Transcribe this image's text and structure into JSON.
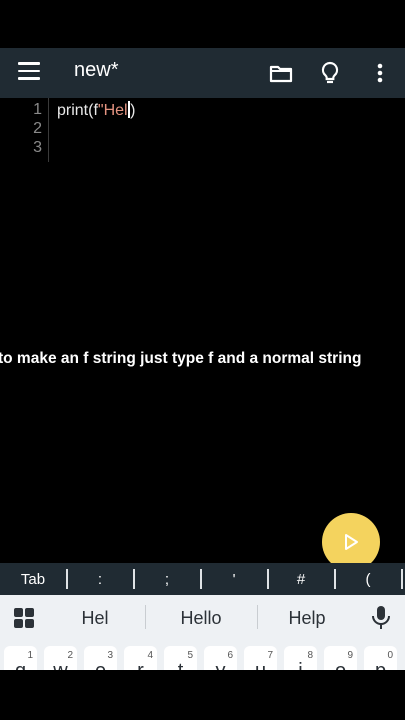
{
  "app_bar": {
    "title": "new*",
    "icons": [
      "menu-icon",
      "folder-icon",
      "lightbulb-icon",
      "more-vert-icon"
    ]
  },
  "editor": {
    "line_numbers": [
      "1",
      "2",
      "3"
    ],
    "line1": {
      "before": "print(f",
      "string": "\"Hel",
      "after": ")"
    }
  },
  "caption": "to make an f string just type f and a normal string",
  "run_button": {
    "icon": "play-icon",
    "color": "#f4d35e"
  },
  "symbol_bar": {
    "items": [
      "Tab",
      ":",
      ";",
      "'",
      "#",
      "("
    ]
  },
  "suggestions": {
    "items": [
      "Hel",
      "Hello",
      "Help"
    ],
    "icons": [
      "keyboard-grid-icon",
      "mic-icon"
    ]
  },
  "keyboard": {
    "keys": [
      {
        "char": "q",
        "hint": "1"
      },
      {
        "char": "w",
        "hint": "2"
      },
      {
        "char": "e",
        "hint": "3"
      },
      {
        "char": "r",
        "hint": "4"
      },
      {
        "char": "t",
        "hint": "5"
      },
      {
        "char": "y",
        "hint": "6"
      },
      {
        "char": "u",
        "hint": "7"
      },
      {
        "char": "i",
        "hint": "8"
      },
      {
        "char": "o",
        "hint": "9"
      },
      {
        "char": "p",
        "hint": "0"
      }
    ]
  },
  "colors": {
    "app_bar_bg": "#202b33",
    "editor_bg": "#000000",
    "string_color": "#e39380",
    "keyboard_bg": "#eef1f4"
  }
}
